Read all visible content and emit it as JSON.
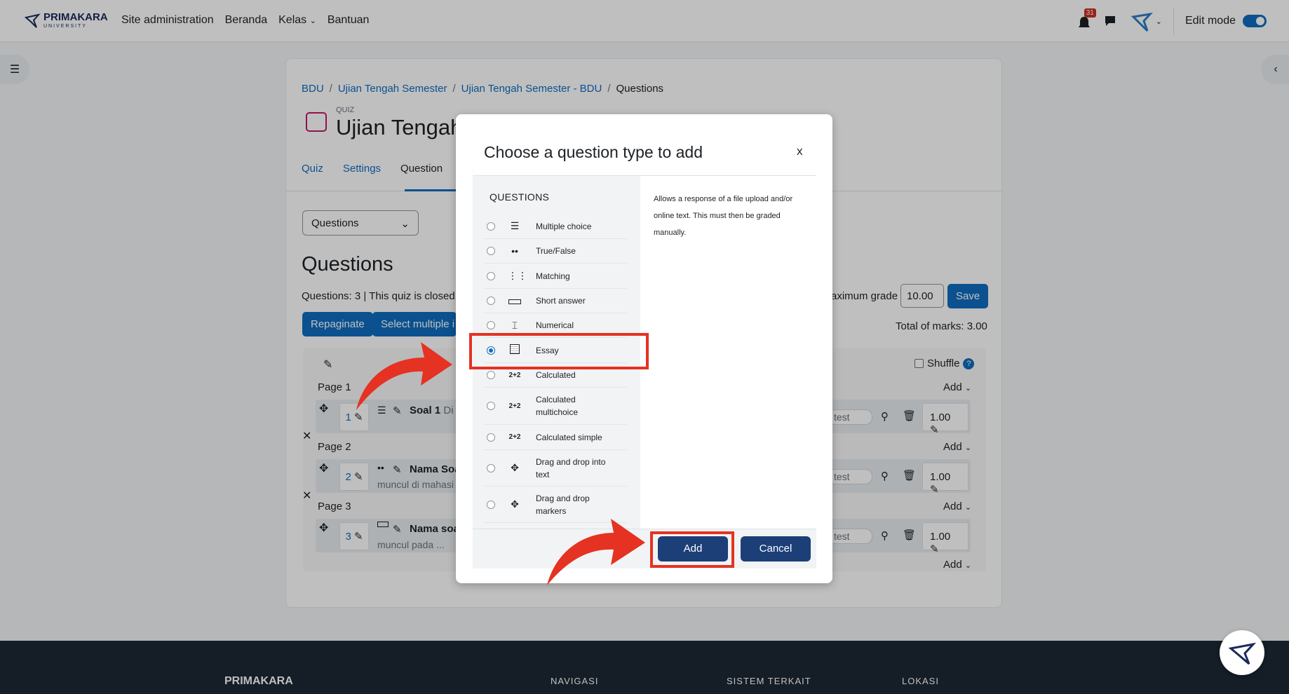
{
  "navbar": {
    "brand": "PRIMAKARA",
    "brand_sub": "UNIVERSITY",
    "links": [
      "Site administration",
      "Beranda",
      "Kelas",
      "Bantuan"
    ],
    "notification_count": "31",
    "edit_mode_label": "Edit mode"
  },
  "breadcrumb": [
    "BDU",
    "Ujian Tengah Semester",
    "Ujian Tengah Semester - BDU",
    "Questions"
  ],
  "header": {
    "type_label": "QUIZ",
    "title": "Ujian Tengah"
  },
  "tabs": [
    "Quiz",
    "Settings",
    "Question"
  ],
  "questions_select": "Questions",
  "main": {
    "heading": "Questions",
    "info": "Questions: 3 | This quiz is closed",
    "repaginate": "Repaginate",
    "select_multiple": "Select multiple i",
    "max_grade_label": "aximum grade",
    "max_grade_value": "10.00",
    "save": "Save",
    "total_marks": "Total of marks: 3.00",
    "shuffle": "Shuffle",
    "add_label": "Add",
    "slots": [
      {
        "page": "Page 1",
        "number": "1",
        "name": "Soal 1",
        "name_rest": "Di",
        "sub": "",
        "preview": "test",
        "mark": "1.00"
      },
      {
        "page": "Page 2",
        "number": "2",
        "name": "Nama Soa",
        "name_rest": "",
        "sub": "muncul di mahasi",
        "preview": "test",
        "mark": "1.00"
      },
      {
        "page": "Page 3",
        "number": "3",
        "name": "Nama soa",
        "name_rest": "",
        "sub": "muncul pada ...",
        "preview": "test",
        "mark": "1.00"
      }
    ]
  },
  "modal": {
    "title": "Choose a question type to add",
    "close": "x",
    "section_heading": "QUESTIONS",
    "options": [
      {
        "label": "Multiple choice",
        "icon": "list-icon"
      },
      {
        "label": "True/False",
        "icon": "dots-icon"
      },
      {
        "label": "Matching",
        "icon": "matching-icon"
      },
      {
        "label": "Short answer",
        "icon": "short-answer-icon"
      },
      {
        "label": "Numerical",
        "icon": "numerical-icon"
      },
      {
        "label": "Essay",
        "icon": "essay-icon"
      },
      {
        "label": "Calculated",
        "icon": "calculated-icon"
      },
      {
        "label": "Calculated multichoice",
        "icon": "calculated-multichoice-icon"
      },
      {
        "label": "Calculated simple",
        "icon": "calculated-simple-icon"
      },
      {
        "label": "Drag and drop into text",
        "icon": "drag-drop-text-icon"
      },
      {
        "label": "Drag and drop markers",
        "icon": "drag-drop-markers-icon"
      }
    ],
    "selected": "Essay",
    "description": "Allows a response of a file upload and/or online text. This must then be graded manually.",
    "add_button": "Add",
    "cancel_button": "Cancel"
  },
  "footer": {
    "brand": "PRIMAKARA",
    "columns": [
      "NAVIGASI",
      "SISTEM TERKAIT",
      "LOKASI"
    ]
  },
  "colors": {
    "primary": "#0f6cbf",
    "modal_button": "#1c3f78",
    "highlight": "#e53222",
    "footer_bg": "#1d2733"
  }
}
